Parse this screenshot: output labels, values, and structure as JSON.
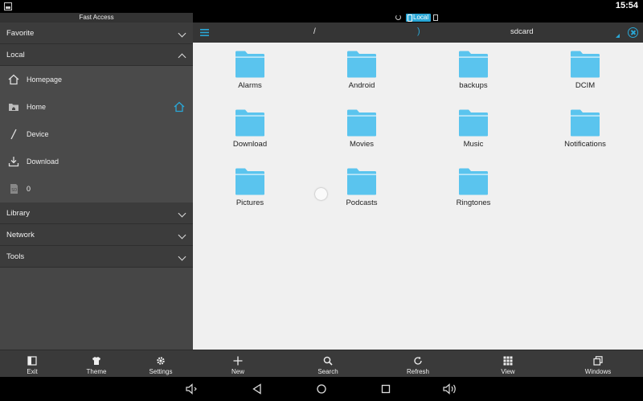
{
  "status_bar": {
    "time": "15:54"
  },
  "sidebar": {
    "header": "Fast Access",
    "sections_top": [
      {
        "label": "Favorite",
        "expanded": false
      },
      {
        "label": "Local",
        "expanded": true
      }
    ],
    "local_items": [
      {
        "label": "Homepage",
        "icon": "house-icon"
      },
      {
        "label": "Home",
        "icon": "home-folder-icon",
        "set_home": true
      },
      {
        "label": "Device",
        "icon": "slash-icon"
      },
      {
        "label": "Download",
        "icon": "download-icon"
      },
      {
        "label": "0",
        "icon": "sd-card-icon"
      }
    ],
    "sections_bottom": [
      {
        "label": "Library",
        "expanded": false
      },
      {
        "label": "Network",
        "expanded": false
      },
      {
        "label": "Tools",
        "expanded": false
      }
    ],
    "bottom_bar": {
      "exit": "Exit",
      "theme": "Theme",
      "settings": "Settings"
    }
  },
  "top_bar": {
    "local_badge": "Local"
  },
  "path_bar": {
    "root": "/",
    "separator": ")",
    "current": "sdcard"
  },
  "folders": [
    "Alarms",
    "Android",
    "backups",
    "DCIM",
    "Download",
    "Movies",
    "Music",
    "Notifications",
    "Pictures",
    "Podcasts",
    "Ringtones"
  ],
  "main_bar": {
    "new": "New",
    "search": "Search",
    "refresh": "Refresh",
    "view": "View",
    "windows": "Windows"
  },
  "colors": {
    "accent": "#2aa7d6",
    "folder": "#5ac4ee",
    "content_bg": "#f0f0f0",
    "sidebar_bg": "#464646"
  }
}
